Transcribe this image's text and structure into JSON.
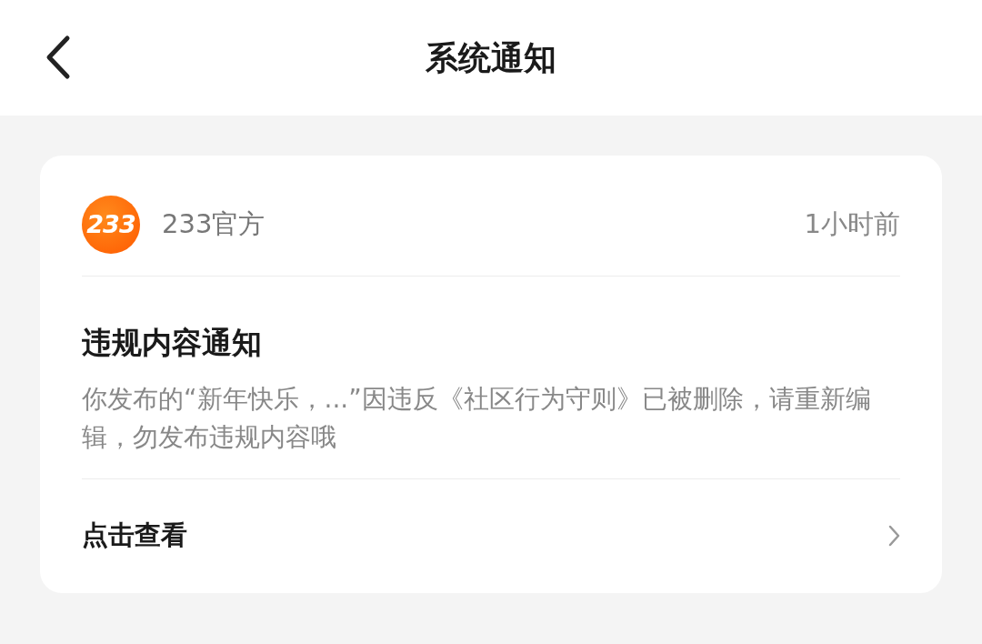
{
  "header": {
    "title": "系统通知"
  },
  "notification": {
    "sender": {
      "logo_text": "233",
      "name": "233官方"
    },
    "time": "1小时前",
    "title": "违规内容通知",
    "body": "你发布的“新年快乐，...”因违反《社区行为守则》已被删除，请重新编辑，勿发布违规内容哦",
    "action": "点击查看"
  }
}
